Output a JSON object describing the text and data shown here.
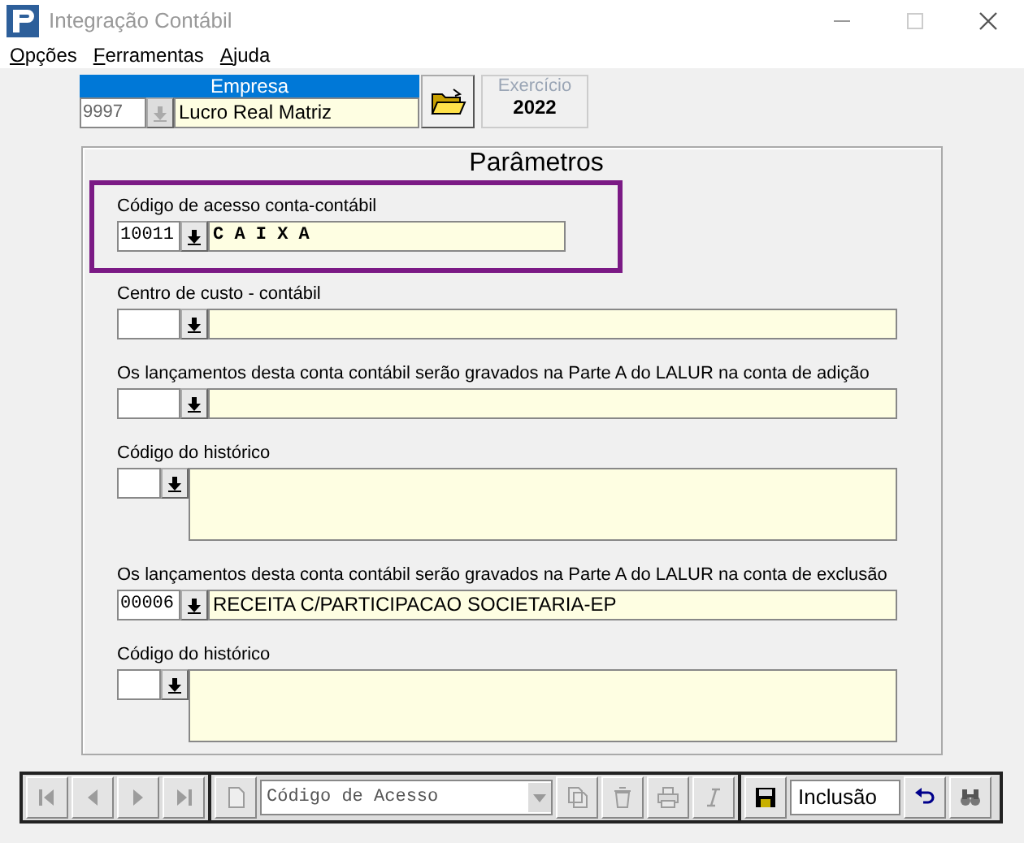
{
  "window": {
    "title": "Integração Contábil",
    "active": false
  },
  "menu": [
    {
      "accel": "O",
      "rest": "pções"
    },
    {
      "accel": "F",
      "rest": "erramentas"
    },
    {
      "accel": "A",
      "rest": "juda"
    }
  ],
  "company": {
    "header": "Empresa",
    "code": "9997",
    "name": "Lucro Real Matriz"
  },
  "fiscal_year": {
    "label": "Exercício",
    "value": "2022",
    "disabled": true
  },
  "panel": {
    "title": "Parâmetros",
    "fields": [
      {
        "kind": "single",
        "label": "Código de acesso conta-contábil",
        "code": "10011",
        "description": "C A I X A",
        "highlighted": true
      },
      {
        "kind": "single",
        "label": "Centro de custo - contábil",
        "highlighted": false
      },
      {
        "kind": "single",
        "label": "Os lançamentos desta conta contábil serão gravados na Parte A do LALUR na conta de adição",
        "highlighted": false
      },
      {
        "kind": "memo",
        "label": "Código do histórico",
        "highlighted": false
      },
      {
        "kind": "single",
        "label": "Os lançamentos desta conta contábil serão gravados na Parte A do LALUR na conta de exclusão",
        "code": "00006",
        "description": "RECEITA C/PARTICIPACAO SOCIETARIA-EP",
        "highlighted": false
      },
      {
        "kind": "memo",
        "label": "Código do histórico",
        "highlighted": false
      }
    ]
  },
  "toolbar": {
    "groups": [
      [
        {
          "kind": "first",
          "disabled": true
        },
        {
          "kind": "prev",
          "disabled": true
        },
        {
          "kind": "next",
          "disabled": true
        },
        {
          "kind": "last",
          "disabled": true
        }
      ],
      [
        {
          "kind": "new",
          "disabled": true
        },
        {
          "kind": "combo",
          "value": "Código de Acesso",
          "disabled": true
        },
        {
          "kind": "copy",
          "disabled": true
        },
        {
          "kind": "delete",
          "disabled": true
        },
        {
          "kind": "print",
          "disabled": true
        },
        {
          "kind": "italic",
          "disabled": true
        }
      ],
      [
        {
          "kind": "save",
          "disabled": false
        },
        {
          "kind": "mode",
          "value": "Inclusão"
        },
        {
          "kind": "undo",
          "disabled": false
        },
        {
          "kind": "find",
          "disabled": false
        }
      ]
    ]
  }
}
